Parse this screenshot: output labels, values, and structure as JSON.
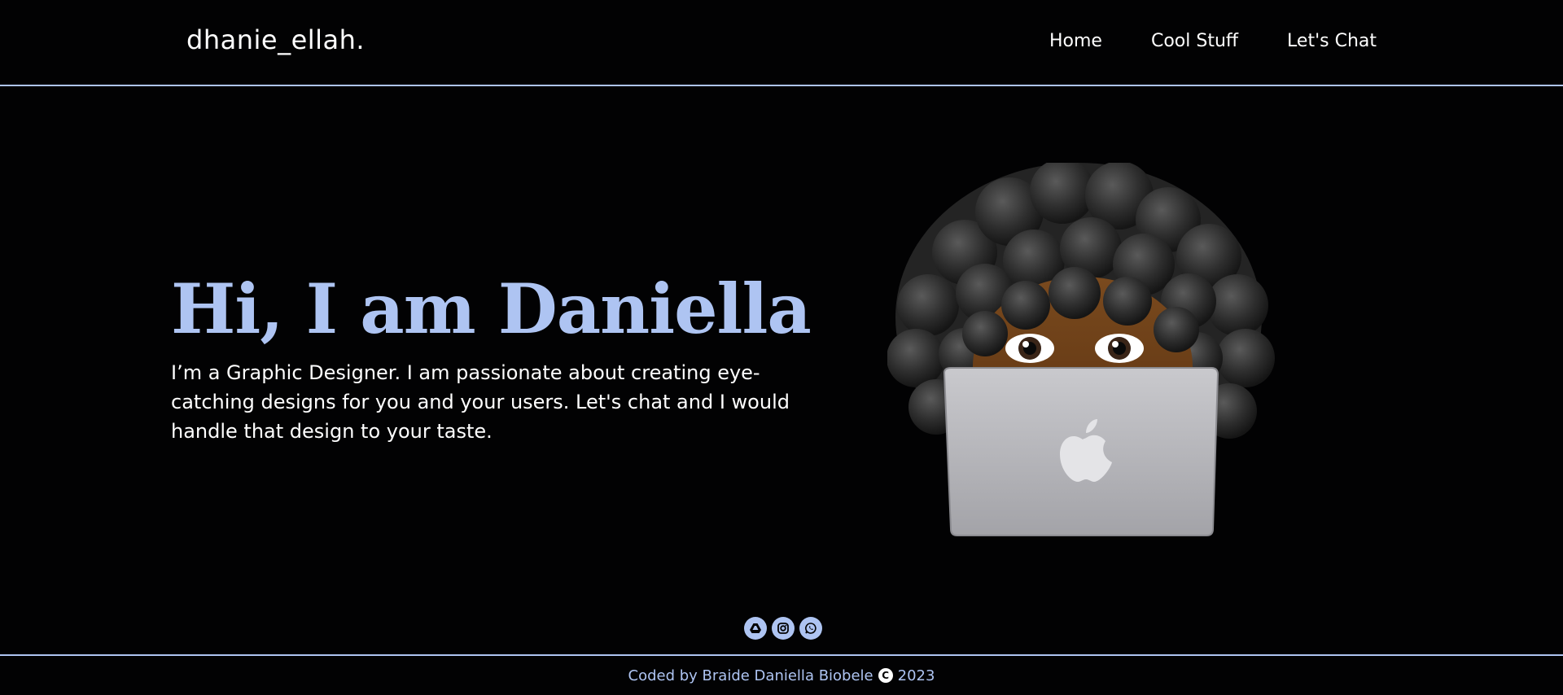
{
  "header": {
    "brand": "dhanie_ellah.",
    "nav": [
      {
        "label": "Home"
      },
      {
        "label": "Cool Stuff"
      },
      {
        "label": "Let's Chat"
      }
    ]
  },
  "hero": {
    "title": "Hi, I am Daniella",
    "description": "I’m a Graphic Designer. I am passionate about creating eye-catching designs for you and your users. Let's chat and I would handle that design to your taste."
  },
  "socials": [
    {
      "icon": "google-drive-icon"
    },
    {
      "icon": "instagram-icon"
    },
    {
      "icon": "whatsapp-icon"
    }
  ],
  "footer": {
    "credit": "Coded by Braide Daniella Biobele",
    "copyright_symbol": "C",
    "year": "2023"
  },
  "colors": {
    "background": "#020203",
    "accent": "#aec4f2",
    "text": "#ffffff"
  }
}
